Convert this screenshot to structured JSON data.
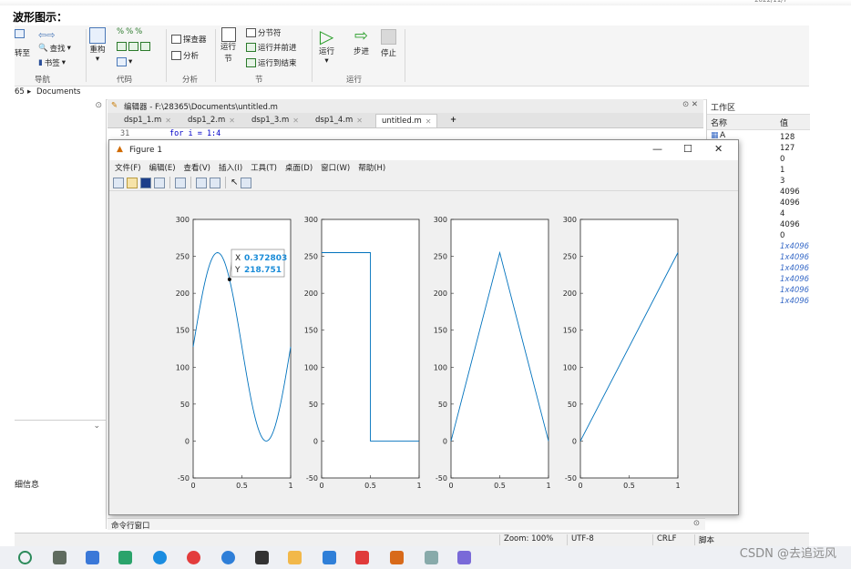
{
  "caption": "波形图示：",
  "ribbon": {
    "nav_group": "导航",
    "code_group": "代码",
    "analyze_group": "分析",
    "section_group": "节",
    "run_group": "运行",
    "goto_label": "转至",
    "find_label": "查找",
    "bookmark_label": "书签",
    "refactor_label": "重构",
    "explorer_label": "探查器",
    "analyze_label": "分析",
    "run_section_label": "运行\n节",
    "section_break_label": "分节符",
    "run_advance_label": "运行并前进",
    "run_to_end_label": "运行到结束",
    "run_label": "运行",
    "step_label": "步进",
    "stop_label": "停止"
  },
  "pathbar": {
    "prefix": "65",
    "folder": "Documents"
  },
  "leftpanel": {
    "label": "细信息"
  },
  "editor": {
    "title": "编辑器 - F:\\28365\\Documents\\untitled.m",
    "tabs": [
      {
        "label": "dsp1_1.m",
        "active": false
      },
      {
        "label": "dsp1_2.m",
        "active": false
      },
      {
        "label": "dsp1_3.m",
        "active": false
      },
      {
        "label": "dsp1_4.m",
        "active": false
      },
      {
        "label": "untitled.m",
        "active": true
      }
    ],
    "add_tab": "+",
    "line_number": "31",
    "code_line": "for i = 1:4"
  },
  "workspace": {
    "title": "工作区",
    "col_name": "名称",
    "col_value": "值",
    "first_var": "A",
    "values": [
      "128",
      "127",
      "0",
      "1",
      "3",
      "4096",
      "4096",
      "4",
      "4096",
      "0"
    ],
    "italic_values": [
      "1x4096",
      "1x4096",
      "1x4096",
      "1x4096",
      "1x4096",
      "1x4096"
    ]
  },
  "figure": {
    "title": "Figure 1",
    "menu": [
      "文件(F)",
      "编辑(E)",
      "查看(V)",
      "插入(I)",
      "工具(T)",
      "桌面(D)",
      "窗口(W)",
      "帮助(H)"
    ],
    "datatip": {
      "x_label": "X",
      "x_value": "0.372803",
      "y_label": "Y",
      "y_value": "218.751"
    }
  },
  "chart_data": [
    {
      "type": "line",
      "name": "sine",
      "x": [
        0,
        0.0625,
        0.125,
        0.1875,
        0.25,
        0.3125,
        0.375,
        0.4375,
        0.5,
        0.5625,
        0.625,
        0.6875,
        0.75,
        0.8125,
        0.875,
        0.9375,
        1
      ],
      "y": [
        127.5,
        177.3,
        217.7,
        244.9,
        255,
        244.9,
        217.7,
        177.3,
        127.5,
        77.7,
        37.3,
        10.1,
        0,
        10.1,
        37.3,
        77.7,
        127.5
      ],
      "ylim": [
        -50,
        300
      ],
      "xlim": [
        0,
        1
      ],
      "xticks": [
        "0",
        "0.5",
        "1"
      ],
      "yticks": [
        "-50",
        "0",
        "50",
        "100",
        "150",
        "200",
        "250",
        "300"
      ]
    },
    {
      "type": "line",
      "name": "square",
      "x": [
        0,
        0.5,
        0.5,
        1
      ],
      "y": [
        255,
        255,
        0,
        0
      ],
      "ylim": [
        -50,
        300
      ],
      "xlim": [
        0,
        1
      ],
      "xticks": [
        "0",
        "0.5",
        "1"
      ],
      "yticks": [
        "-50",
        "0",
        "50",
        "100",
        "150",
        "200",
        "250",
        "300"
      ]
    },
    {
      "type": "line",
      "name": "triangle",
      "x": [
        0,
        0.5,
        1
      ],
      "y": [
        0,
        255,
        0
      ],
      "ylim": [
        -50,
        300
      ],
      "xlim": [
        0,
        1
      ],
      "xticks": [
        "0",
        "0.5",
        "1"
      ],
      "yticks": [
        "-50",
        "0",
        "50",
        "100",
        "150",
        "200",
        "250",
        "300"
      ]
    },
    {
      "type": "line",
      "name": "sawtooth",
      "x": [
        0,
        1
      ],
      "y": [
        0,
        255
      ],
      "ylim": [
        -50,
        300
      ],
      "xlim": [
        0,
        1
      ],
      "xticks": [
        "0",
        "0.5",
        "1"
      ],
      "yticks": [
        "-50",
        "0",
        "50",
        "100",
        "150",
        "200",
        "250",
        "300"
      ]
    }
  ],
  "cmdwin": {
    "label": "命令行窗口"
  },
  "status": {
    "zoom": "Zoom: 100%",
    "encoding": "UTF-8",
    "eol": "CRLF",
    "mode": "脚本"
  },
  "watermark": "CSDN @去追远风",
  "colors": {
    "line": "#0072bd",
    "accent": "#3a6cc8",
    "tip_value": "#1a8cd8"
  }
}
